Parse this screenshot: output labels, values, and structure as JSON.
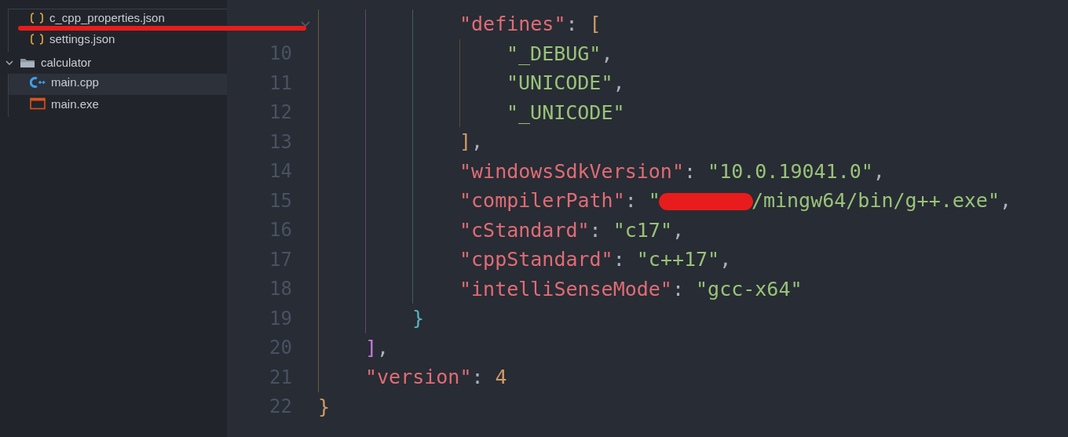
{
  "explorer": {
    "tree": [
      {
        "kind": "cut-folder",
        "children": [
          {
            "kind": "json",
            "name": "c_cpp_properties.json",
            "selected": false,
            "highlighted": true
          },
          {
            "kind": "json",
            "name": "settings.json",
            "selected": false,
            "highlighted": false
          }
        ]
      },
      {
        "kind": "folder",
        "name": "calculator",
        "expanded": true,
        "children": [
          {
            "kind": "cpp",
            "name": "main.cpp",
            "selected": true,
            "highlighted": false
          },
          {
            "kind": "exe",
            "name": "main.exe",
            "selected": false,
            "highlighted": false
          }
        ]
      }
    ]
  },
  "editor": {
    "blocks": [
      {
        "kind": "cut",
        "children": [
          {
            "kind": "cut",
            "children": [
              {
                "kind": "cut",
                "children": [
                  {
                    "kind": "line",
                    "tokens": [
                      {
                        "kind": "key",
                        "text": "\"defines\""
                      },
                      {
                        "kind": "punct",
                        "text": ": "
                      },
                      {
                        "kind": "bracket",
                        "text": "[",
                        "color": "#d19a66"
                      }
                    ],
                    "children": [
                      {
                        "kind": "line",
                        "number": "10",
                        "tokens": [
                          {
                            "kind": "string",
                            "text": "\"_DEBUG\""
                          },
                          {
                            "kind": "punct",
                            "text": ","
                          }
                        ]
                      },
                      {
                        "kind": "line",
                        "number": "11",
                        "tokens": [
                          {
                            "kind": "string",
                            "text": "\"UNICODE\""
                          },
                          {
                            "kind": "punct",
                            "text": ","
                          }
                        ]
                      },
                      {
                        "kind": "line",
                        "number": "12",
                        "tokens": [
                          {
                            "kind": "string",
                            "text": "\"_UNICODE\""
                          }
                        ]
                      }
                    ]
                  },
                  {
                    "kind": "line",
                    "number": "13",
                    "tokens": [
                      {
                        "kind": "bracket",
                        "text": "]",
                        "color": "#d19a66"
                      },
                      {
                        "kind": "punct",
                        "text": ","
                      }
                    ]
                  },
                  {
                    "kind": "line",
                    "number": "14",
                    "tokens": [
                      {
                        "kind": "key",
                        "text": "\"windowsSdkVersion\""
                      },
                      {
                        "kind": "punct",
                        "text": ": "
                      },
                      {
                        "kind": "string",
                        "text": "\"10.0.19041.0\""
                      },
                      {
                        "kind": "punct",
                        "text": ","
                      }
                    ]
                  },
                  {
                    "kind": "line",
                    "number": "15",
                    "tokens": [
                      {
                        "kind": "key",
                        "text": "\"compilerPath\""
                      },
                      {
                        "kind": "punct",
                        "text": ": "
                      },
                      {
                        "kind": "string",
                        "text": "\""
                      },
                      {
                        "kind": "redacted"
                      },
                      {
                        "kind": "string",
                        "text": "/mingw64/bin/g++.exe\""
                      },
                      {
                        "kind": "punct",
                        "text": ","
                      }
                    ]
                  },
                  {
                    "kind": "line",
                    "number": "16",
                    "tokens": [
                      {
                        "kind": "key",
                        "text": "\"cStandard\""
                      },
                      {
                        "kind": "punct",
                        "text": ": "
                      },
                      {
                        "kind": "string",
                        "text": "\"c17\""
                      },
                      {
                        "kind": "punct",
                        "text": ","
                      }
                    ]
                  },
                  {
                    "kind": "line",
                    "number": "17",
                    "tokens": [
                      {
                        "kind": "key",
                        "text": "\"cppStandard\""
                      },
                      {
                        "kind": "punct",
                        "text": ": "
                      },
                      {
                        "kind": "string",
                        "text": "\"c++17\""
                      },
                      {
                        "kind": "punct",
                        "text": ","
                      }
                    ]
                  },
                  {
                    "kind": "line",
                    "number": "18",
                    "tokens": [
                      {
                        "kind": "key",
                        "text": "\"intelliSenseMode\""
                      },
                      {
                        "kind": "punct",
                        "text": ": "
                      },
                      {
                        "kind": "string",
                        "text": "\"gcc-x64\""
                      }
                    ]
                  }
                ]
              },
              {
                "kind": "line",
                "number": "19",
                "tokens": [
                  {
                    "kind": "bracket",
                    "text": "}",
                    "color": "#56b6c2"
                  }
                ]
              }
            ]
          },
          {
            "kind": "line",
            "number": "20",
            "tokens": [
              {
                "kind": "bracket",
                "text": "]",
                "color": "#c678dd"
              },
              {
                "kind": "punct",
                "text": ","
              }
            ]
          },
          {
            "kind": "line",
            "number": "21",
            "tokens": [
              {
                "kind": "key",
                "text": "\"version\""
              },
              {
                "kind": "punct",
                "text": ": "
              },
              {
                "kind": "number",
                "text": "4"
              }
            ]
          }
        ]
      },
      {
        "kind": "line",
        "number": "22",
        "tokens": [
          {
            "kind": "bracket",
            "text": "}",
            "color": "#d19a66"
          }
        ]
      }
    ]
  }
}
